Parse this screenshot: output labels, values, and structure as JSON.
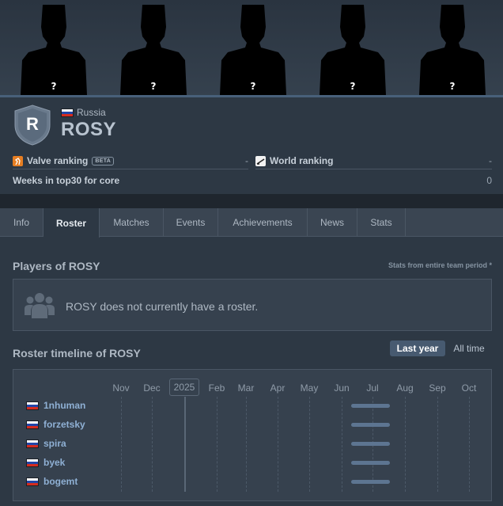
{
  "banner": {
    "players": [
      {
        "label": "?"
      },
      {
        "label": "?"
      },
      {
        "label": "?"
      },
      {
        "label": "?"
      },
      {
        "label": "?"
      }
    ]
  },
  "team": {
    "logo_letter": "R",
    "country": "Russia",
    "name": "ROSY"
  },
  "rankings": {
    "valve_label": "Valve ranking",
    "valve_badge": "BETA",
    "valve_value": "-",
    "world_label": "World ranking",
    "world_value": "-"
  },
  "weeks": {
    "label": "Weeks in top30 for core",
    "value": "0"
  },
  "tabs": [
    {
      "label": "Info",
      "active": false
    },
    {
      "label": "Roster",
      "active": true
    },
    {
      "label": "Matches",
      "active": false
    },
    {
      "label": "Events",
      "active": false
    },
    {
      "label": "Achievements",
      "active": false
    },
    {
      "label": "News",
      "active": false
    },
    {
      "label": "Stats",
      "active": false
    }
  ],
  "players_section": {
    "title": "Players of ROSY",
    "stats_note": "Stats from entire team period *",
    "empty_message": "ROSY does not currently have a roster."
  },
  "timeline": {
    "title": "Roster timeline of ROSY",
    "range_active": "Last year",
    "range_other": "All time",
    "months": [
      "Nov",
      "Dec",
      "Feb",
      "Mar",
      "Apr",
      "May",
      "Jun",
      "Jul",
      "Aug",
      "Sep",
      "Oct"
    ],
    "year_marker": "2025",
    "players": [
      {
        "name": "1nhuman",
        "country": "Russia"
      },
      {
        "name": "forzetsky",
        "country": "Russia"
      },
      {
        "name": "spira",
        "country": "Russia"
      },
      {
        "name": "byek",
        "country": "Russia"
      },
      {
        "name": "bogemt",
        "country": "Russia"
      }
    ]
  },
  "colors": {
    "background": "#2d3844",
    "accent": "#475a70",
    "link": "#8fb0d4",
    "bar": "#5d7591"
  }
}
